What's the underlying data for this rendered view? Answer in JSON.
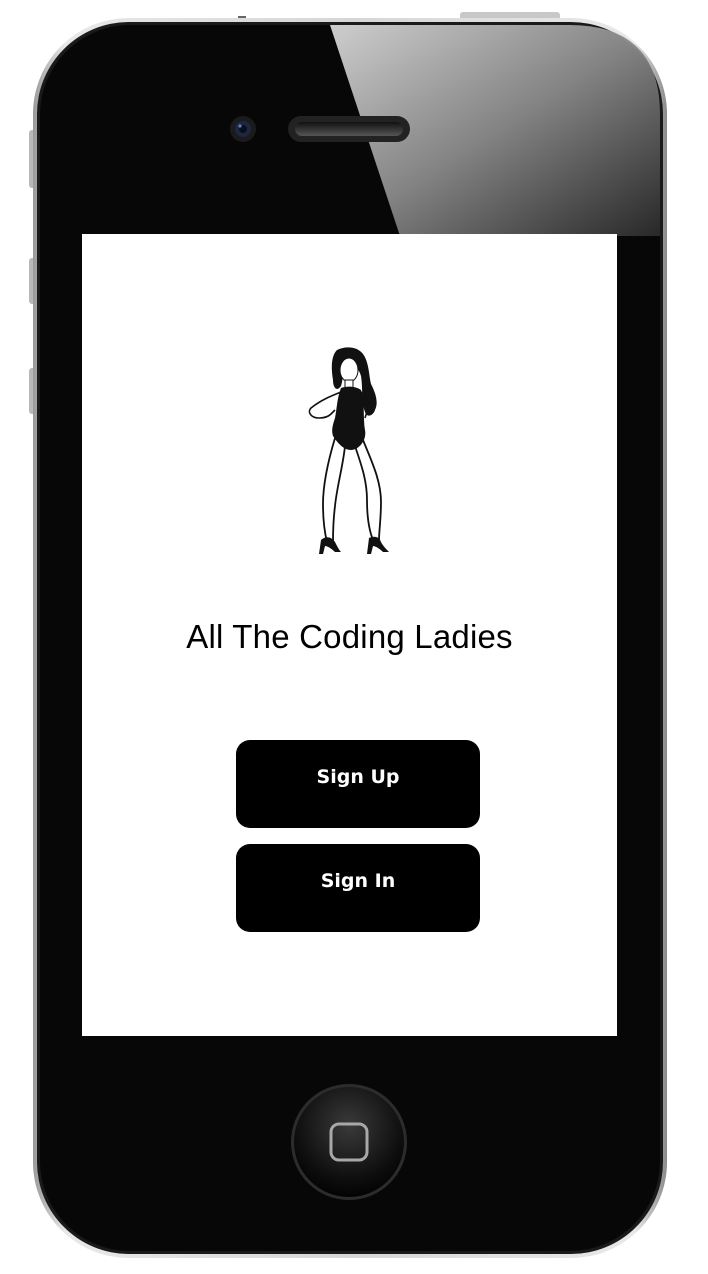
{
  "app": {
    "title": "All The Coding Ladies"
  },
  "actions": {
    "sign_up_label": "Sign Up",
    "sign_in_label": "Sign In"
  },
  "icons": {
    "logo": "woman-silhouette-icon",
    "home_button": "home-square-icon"
  },
  "colors": {
    "button_bg": "#000000",
    "button_text": "#ffffff",
    "screen_bg": "#ffffff",
    "device_body": "#0a0a0a"
  }
}
